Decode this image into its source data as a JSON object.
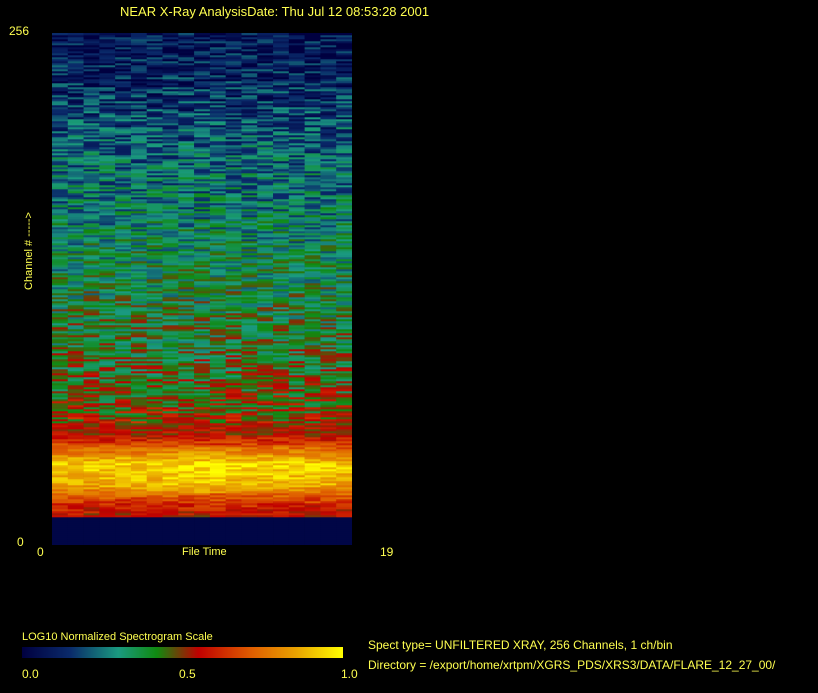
{
  "header": {
    "title": "NEAR X-Ray Analysis",
    "date": "Date: Thu Jul 12 08:53:28 2001"
  },
  "chart_data": {
    "type": "heatmap",
    "xlabel": "File Time",
    "ylabel": "Channel # ----->",
    "xlim": [
      0,
      19
    ],
    "ylim": [
      0,
      256
    ],
    "x_ticks": [
      "0",
      "19"
    ],
    "y_ticks": [
      "0",
      "256"
    ],
    "columns": 19,
    "channels": 256,
    "profile": {
      "channels": [
        0,
        13,
        14,
        20,
        30,
        40,
        48,
        55,
        70,
        100,
        150,
        200,
        230,
        256
      ],
      "intensity": [
        0.02,
        0.02,
        0.55,
        0.62,
        0.85,
        0.9,
        0.7,
        0.55,
        0.48,
        0.4,
        0.32,
        0.22,
        0.12,
        0.06
      ]
    },
    "colorbar": {
      "title": "LOG10 Normalized Spectrogram Scale",
      "ticks": [
        "0.0",
        "0.5",
        "1.0"
      ],
      "range": [
        0,
        1
      ]
    }
  },
  "info": {
    "spect_type": "Spect type= UNFILTERED XRAY,  256 Channels,  1 ch/bin",
    "directory": "Directory = /export/home/xrtpm/XGRS_PDS/XRS3/DATA/FLARE_12_27_00/"
  }
}
